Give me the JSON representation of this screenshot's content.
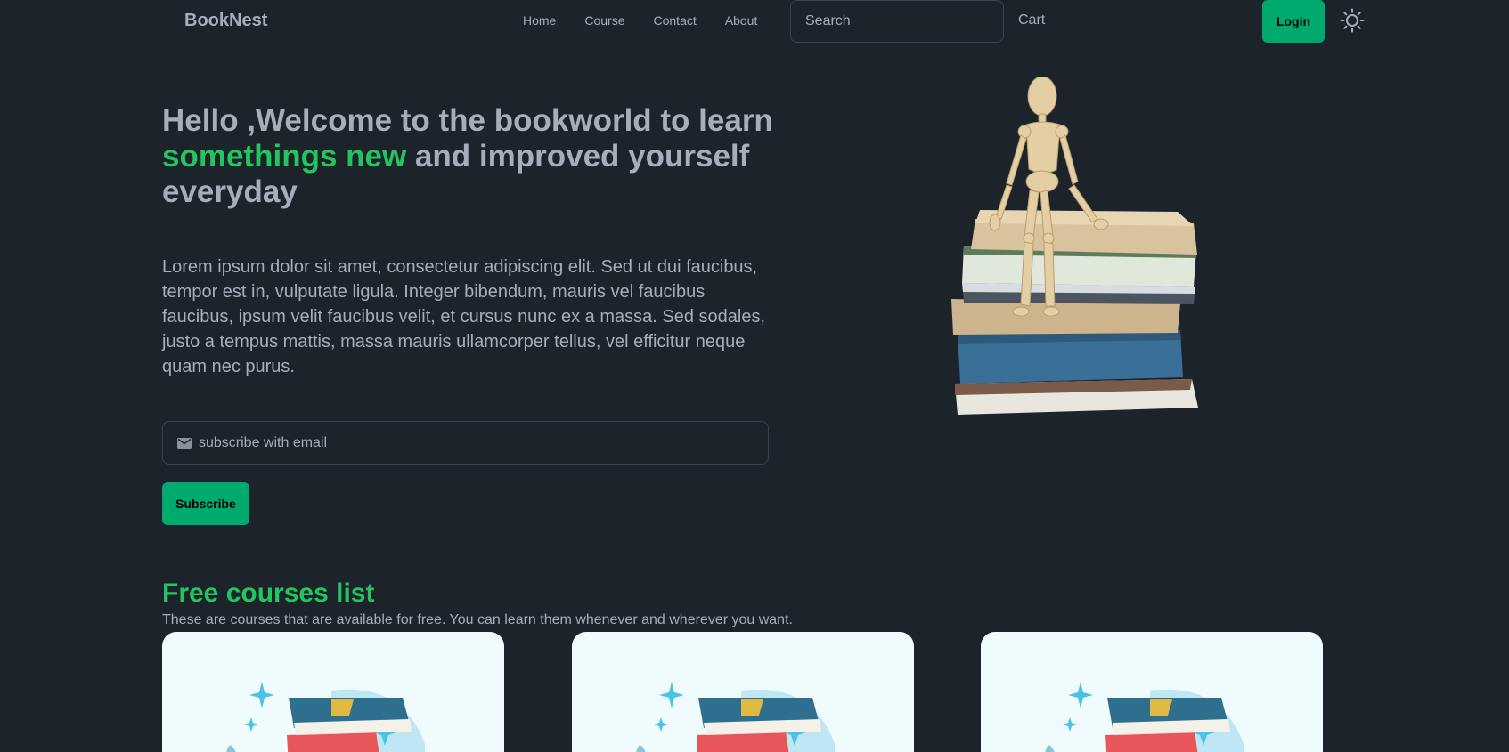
{
  "brand": "BookNest",
  "nav": {
    "home": "Home",
    "course": "Course",
    "contact": "Contact",
    "about": "About"
  },
  "search": {
    "placeholder": "Search"
  },
  "cart": "Cart",
  "login": "Login",
  "hero": {
    "title_part1": "Hello ,Welcome to the bookworld to learn ",
    "title_accent": "somethings new",
    "title_part2": " and improved yourself everyday",
    "description": "Lorem ipsum dolor sit amet, consectetur adipiscing elit. Sed ut dui faucibus, tempor est in, vulputate ligula. Integer bibendum, mauris vel faucibus faucibus, ipsum velit faucibus velit, et cursus nunc ex a massa. Sed sodales, justo a tempus mattis, massa mauris ullamcorper tellus, vel efficitur neque quam nec purus.",
    "email_placeholder": "subscribe with email",
    "subscribe": "Subscribe"
  },
  "courses": {
    "title": "Free courses list",
    "subtitle": "These are courses that are available for free. You can learn them whenever and wherever you want."
  },
  "colors": {
    "accent": "#22c55e",
    "button": "#00a96e",
    "background": "#1d232a",
    "card": "#effbfd"
  },
  "icons": [
    "search-icon",
    "sun-icon",
    "mail-icon"
  ]
}
